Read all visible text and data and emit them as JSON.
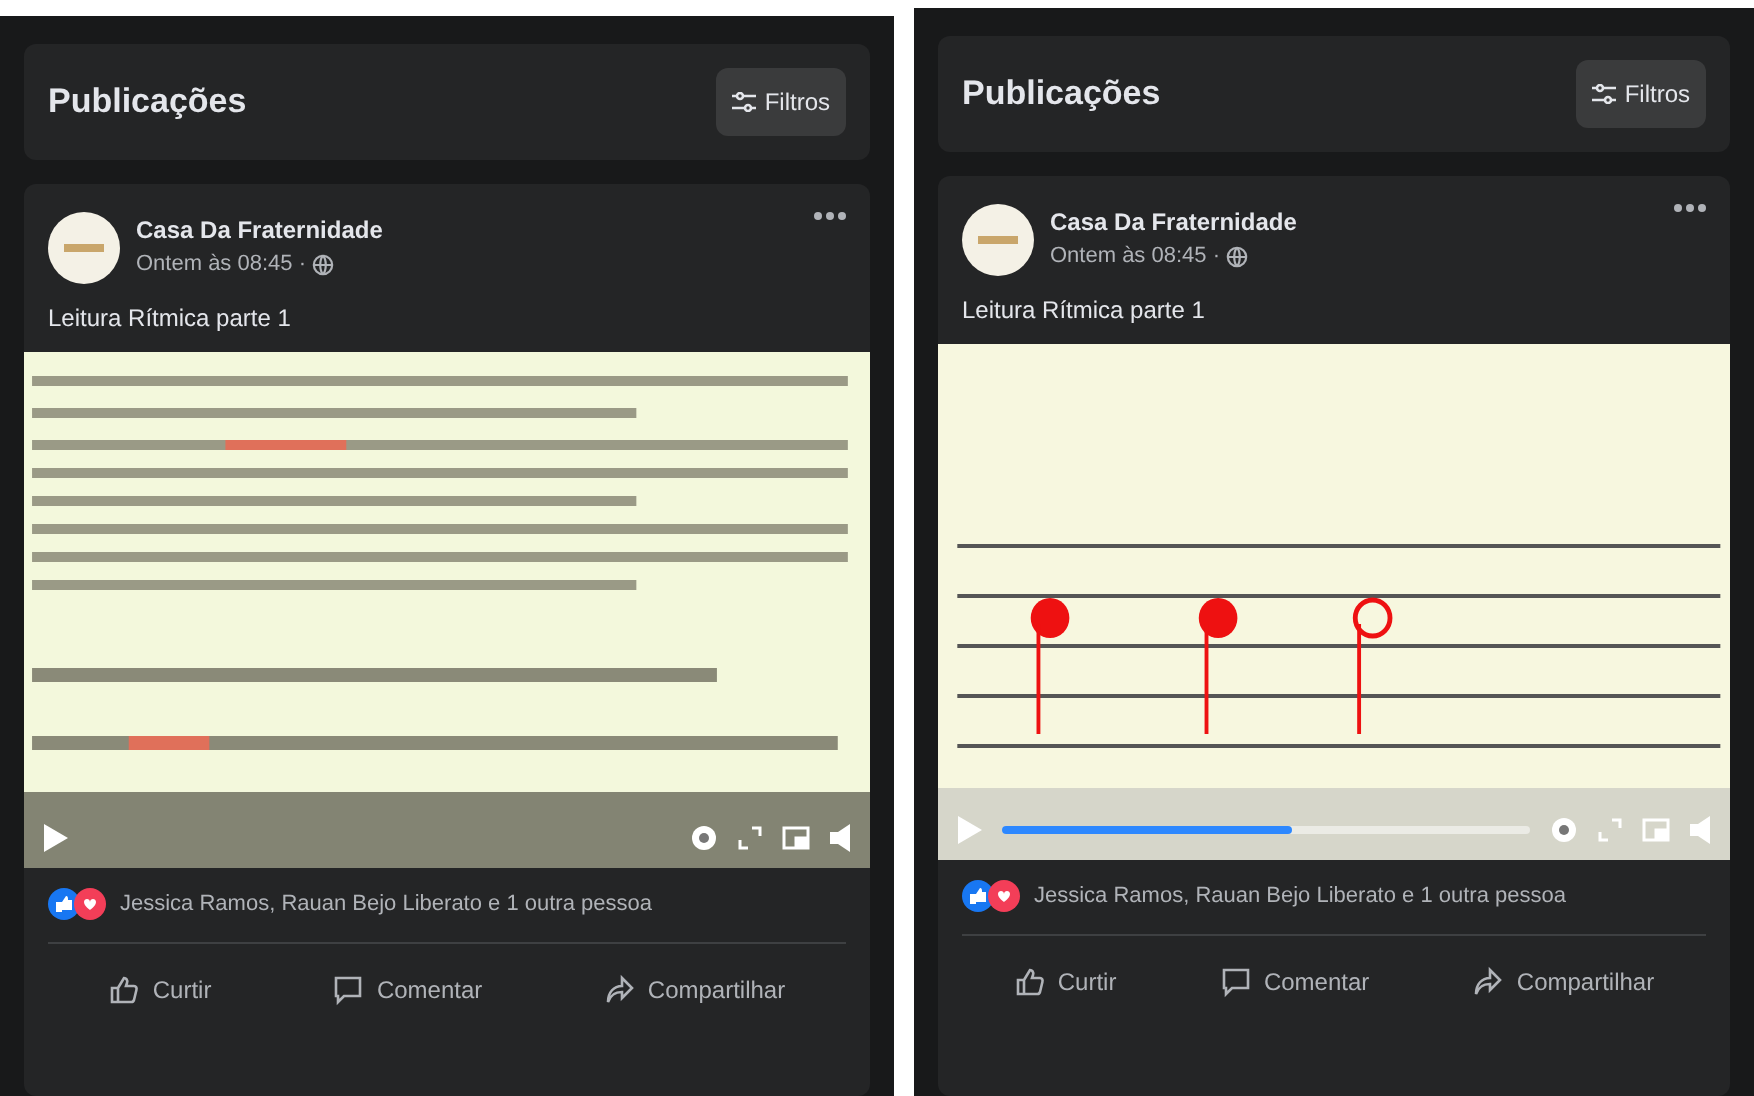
{
  "panels": [
    {
      "header": {
        "title": "Publicações",
        "filter_button": "Filtros"
      },
      "post": {
        "author": "Casa Da Fraternidade",
        "time": "Ontem às 08:45 ·",
        "text": "Leitura Rítmica parte 1",
        "reactions": "Jessica Ramos, Rauan Bejo Liberato e 1 outra pessoa",
        "actions": [
          "Curtir",
          "Comentar",
          "Compartilhar"
        ]
      }
    },
    {
      "header": {
        "title": "Publicações",
        "filter_button": "Filtros"
      },
      "post": {
        "author": "Casa Da Fraternidade",
        "time": "Ontem às 08:45 ·",
        "text": "Leitura Rítmica parte 1",
        "video": {
          "kind": "picture",
          "level": 0.55
        },
        "reactions": "Jessica Ramos, Rauan Bejo Liberato e 1 outra pessoa",
        "actions": [
          "Curtir",
          "Comentar",
          "Compartilhar"
        ]
      }
    }
  ]
}
